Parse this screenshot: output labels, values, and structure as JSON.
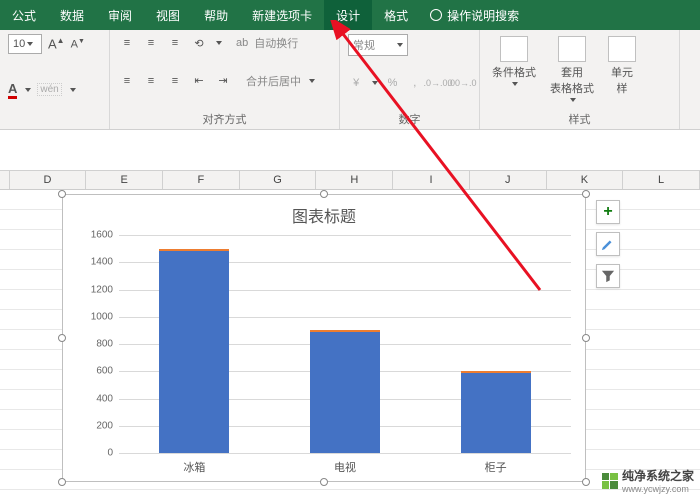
{
  "tabs": {
    "formula": "公式",
    "data": "数据",
    "review": "审阅",
    "view": "视图",
    "help": "帮助",
    "newtab": "新建选项卡",
    "design": "设计",
    "format": "格式",
    "tellme": "操作说明搜索"
  },
  "ribbon": {
    "font_size": "10",
    "wrap": "自动换行",
    "merge": "合并后居中",
    "align_group": "对齐方式",
    "nf_selected": "常规",
    "number_group": "数字",
    "cond_fmt": "条件格式",
    "tbl_fmt": "套用\n表格格式",
    "cell_styles": "单元\n样",
    "styles_group": "样式"
  },
  "columns": [
    "D",
    "E",
    "F",
    "G",
    "H",
    "I",
    "J",
    "K",
    "L"
  ],
  "chart_data": {
    "type": "bar",
    "title": "图表标题",
    "categories": [
      "冰箱",
      "电视",
      "柜子"
    ],
    "values": [
      1500,
      900,
      600
    ],
    "ylim": [
      0,
      1600
    ],
    "ystep": 200,
    "xlabel": "",
    "ylabel": ""
  },
  "side_buttons": {
    "add": "+",
    "style": "brush",
    "filter": "funnel"
  },
  "watermark": {
    "text": "纯净系统之家",
    "url": "www.ycwjzy.com"
  }
}
